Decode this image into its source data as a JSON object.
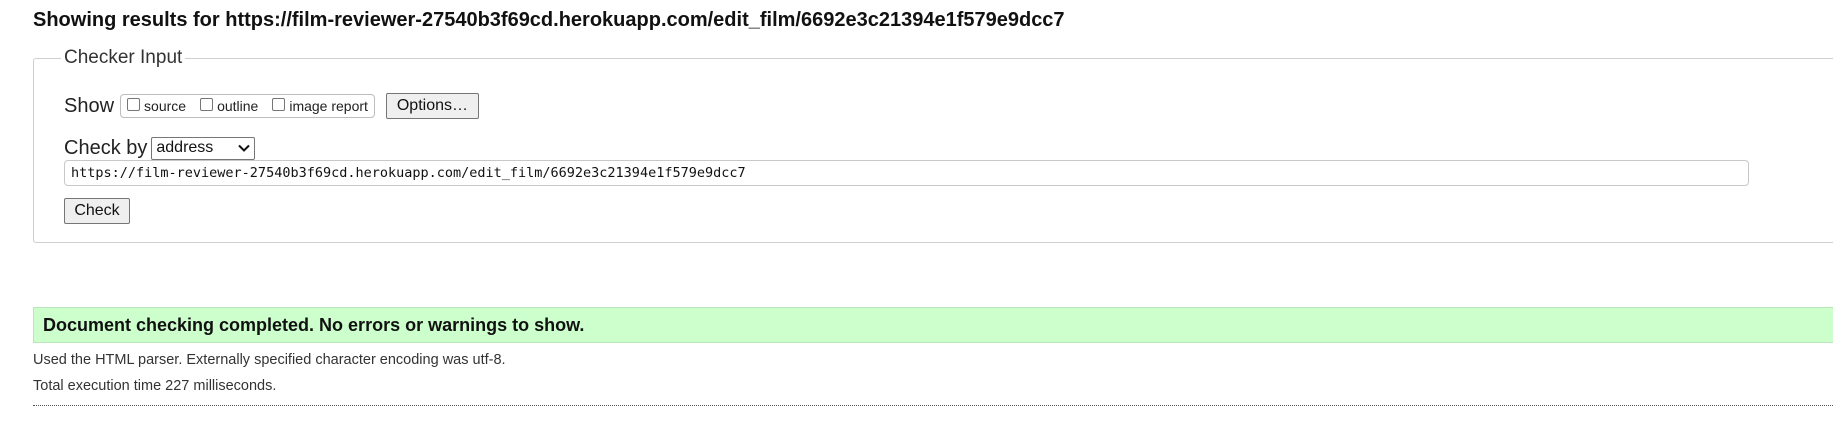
{
  "header": {
    "prefix": "Showing results for",
    "url": "https://film-reviewer-27540b3f69cd.herokuapp.com/edit_film/6692e3c21394e1f579e9dcc7"
  },
  "checker": {
    "legend": "Checker Input",
    "show_label": "Show",
    "show_options": [
      {
        "label": "source",
        "checked": false
      },
      {
        "label": "outline",
        "checked": false
      },
      {
        "label": "image report",
        "checked": false
      }
    ],
    "options_button": "Options…",
    "check_by_label": "Check by",
    "check_by_selected": "address",
    "url_value": "https://film-reviewer-27540b3f69cd.herokuapp.com/edit_film/6692e3c21394e1f579e9dcc7",
    "check_button": "Check"
  },
  "result": {
    "message": "Document checking completed. No errors or warnings to show.",
    "color": "#ccffcc"
  },
  "details": {
    "parser": "Used the HTML parser. Externally specified character encoding was utf-8.",
    "time": "Total execution time 227 milliseconds."
  }
}
